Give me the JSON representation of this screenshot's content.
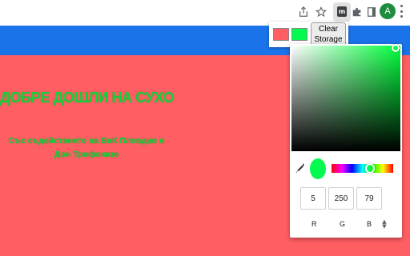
{
  "toolbar": {
    "icons": [
      "share-icon",
      "bookmark-star-icon",
      "extension-m-icon",
      "puzzle-icon",
      "side-panel-icon"
    ],
    "extension_glyph": "m",
    "avatar_initial": "A"
  },
  "page": {
    "background": "#ff5e63",
    "bar_color": "#1a73e8",
    "title": "ДОБРЕ ДОШЛИ НА СУХО",
    "subtitle_line1": "Със съдействието на ВиК Пловдив и",
    "subtitle_line2": "Дон Трифонкзе",
    "text_color": "#1bd33c"
  },
  "popup": {
    "swatch1_color": "#ff5e63",
    "swatch2_color": "#05fa4f",
    "clear_line1": "Clear",
    "clear_line2": "Storage"
  },
  "picker": {
    "selected_color": "#05fa4f",
    "r": "5",
    "g": "250",
    "b": "79",
    "labels": {
      "r": "R",
      "g": "G",
      "b": "B"
    }
  }
}
